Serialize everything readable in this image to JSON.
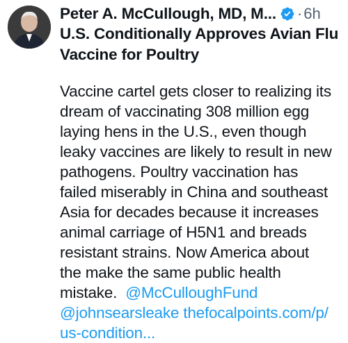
{
  "author": {
    "display_name": "Peter A. McCullough, MD, M...",
    "verified_icon": "verified-badge-icon",
    "separator": "·",
    "timestamp": "6h"
  },
  "headline": {
    "lines": [
      "U.S. Conditionally Approves Avian Flu",
      "Vaccine for Poultry"
    ]
  },
  "body": {
    "lines": [
      "Vaccine cartel gets closer to realizing its",
      "dream of vaccinating 308 million egg",
      "laying hens in the U.S., even though",
      "leaky vaccines are likely to result in new",
      "pathogens.  Poultry vaccination has",
      "failed miserably in China and southeast",
      "Asia for decades because it increases",
      "animal carriage of H5N1 and breads",
      "resistant strains. Now America about",
      "the make the same public health"
    ],
    "last_line_prefix": "mistake.  ",
    "mention_1": "@McCulloughFund",
    "mention_2": "@johnsearsleake",
    "link_part_1": "thefocalpoints.com/p/",
    "link_part_2": "us-condition..."
  },
  "colors": {
    "text": "#0f1419",
    "muted": "#536471",
    "link": "#1d9bf0",
    "verified": "#1d9bf0"
  }
}
